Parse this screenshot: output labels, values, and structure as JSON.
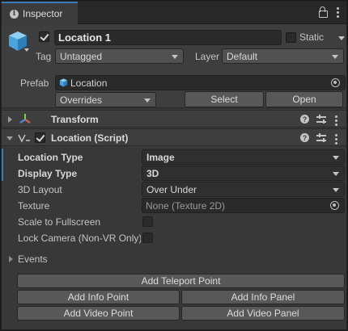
{
  "tab": {
    "title": "Inspector"
  },
  "header": {
    "name": "Location 1",
    "static_label": "Static",
    "tag_label": "Tag",
    "tag_value": "Untagged",
    "layer_label": "Layer",
    "layer_value": "Default",
    "prefab_label": "Prefab",
    "prefab_value": "Location",
    "overrides_label": "Overrides",
    "select_label": "Select",
    "open_label": "Open"
  },
  "components": {
    "transform": {
      "title": "Transform"
    },
    "script": {
      "title": "Location (Script)"
    }
  },
  "fields": {
    "location_type": {
      "label": "Location Type",
      "value": "Image"
    },
    "display_type": {
      "label": "Display Type",
      "value": "3D"
    },
    "layout_3d": {
      "label": "3D Layout",
      "value": "Over Under"
    },
    "texture": {
      "label": "Texture",
      "value": "None (Texture 2D)"
    },
    "scale_fullscreen": {
      "label": "Scale to Fullscreen",
      "checked": false
    },
    "lock_camera": {
      "label": "Lock Camera (Non-VR Only)",
      "checked": false
    },
    "events": {
      "label": "Events"
    }
  },
  "buttons": {
    "add_teleport_point": "Add Teleport Point",
    "add_info_point": "Add Info Point",
    "add_info_panel": "Add Info Panel",
    "add_video_point": "Add Video Point",
    "add_video_panel": "Add Video Panel"
  },
  "colors": {
    "accent": "#3a79bb",
    "cube_blue": "#4aa3df"
  }
}
